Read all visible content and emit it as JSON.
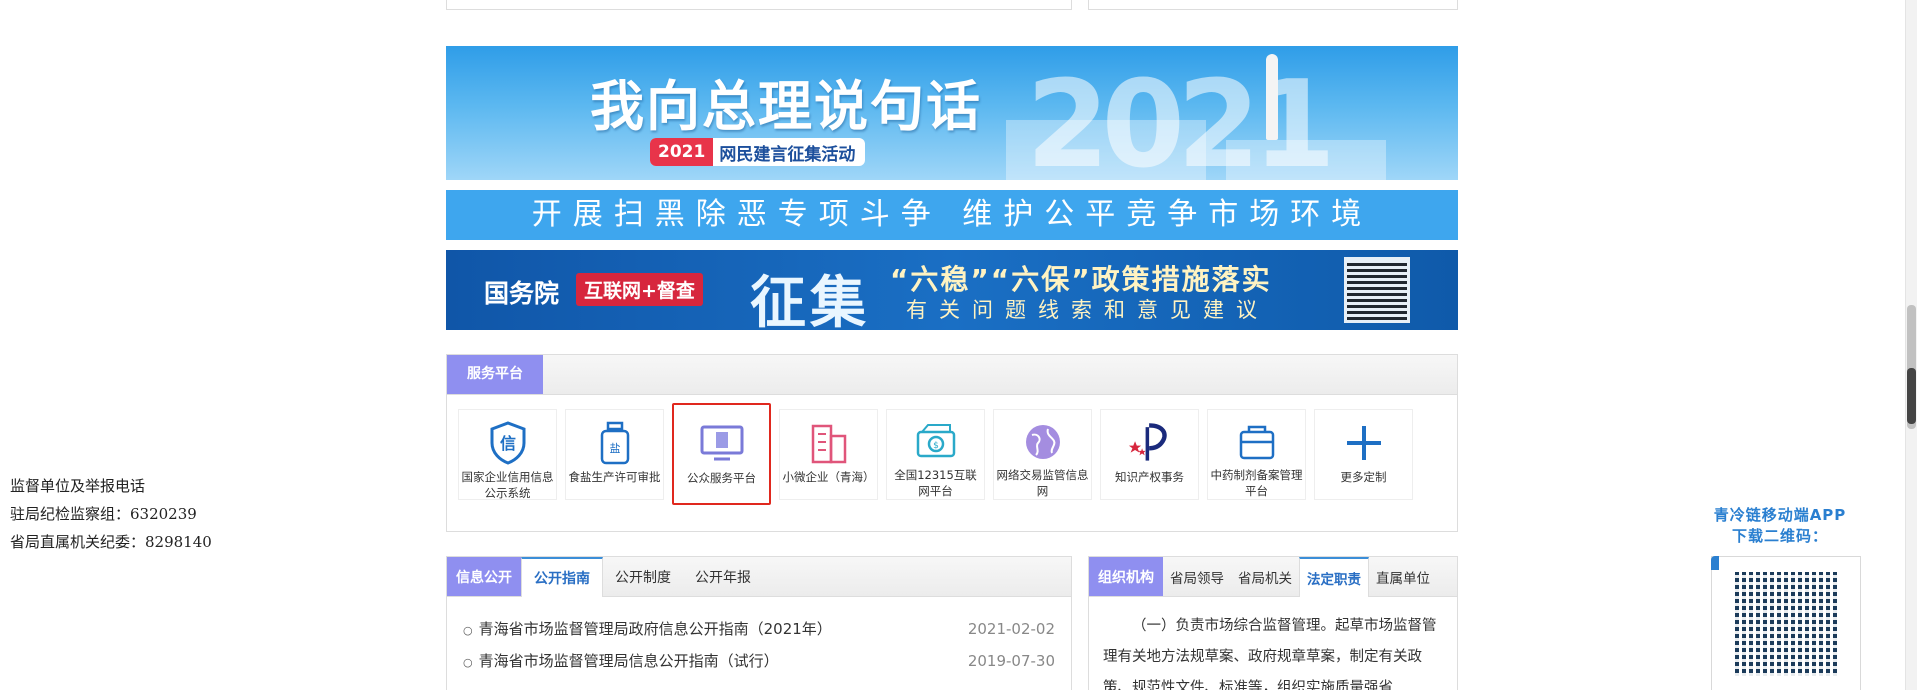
{
  "left_info": {
    "line1": "监督单位及举报电话",
    "line2": "驻局纪检监察组：6320239",
    "line3": "省局直属机关纪委：8298140"
  },
  "banner1": {
    "title": "我向总理说句话",
    "year": "2021",
    "subtitle": "网民建言征集活动",
    "deco_year": "2021"
  },
  "banner2": {
    "text": "开展扫黑除恶专项斗争  维护公平竞争市场环境"
  },
  "banner3": {
    "gwy": "国务院",
    "hlw": "互联网+督查",
    "zj": "征集",
    "line1": "“六稳”“六保”政策措施落实",
    "line2": "有关问题线索和意见建议"
  },
  "service": {
    "tab": "服务平台",
    "items": [
      {
        "label": "国家企业信用信息公示系统",
        "icon": "credit-shield-icon"
      },
      {
        "label": "食盐生产许可审批",
        "icon": "salt-jar-icon"
      },
      {
        "label": "公众服务平台",
        "icon": "monitor-document-icon"
      },
      {
        "label": "小微企业（青海）",
        "icon": "building-icon"
      },
      {
        "label": "全国12315互联网平台",
        "icon": "money-bill-icon"
      },
      {
        "label": "网络交易监管信息网",
        "icon": "globe-icon"
      },
      {
        "label": "知识产权事务",
        "icon": "ip-logo-icon"
      },
      {
        "label": "中药制剂备案管理平台",
        "icon": "folder-icon"
      },
      {
        "label": "更多定制",
        "icon": "plus-icon"
      }
    ]
  },
  "info": {
    "lead": "信息公开",
    "tabs": [
      "公开指南",
      "公开制度",
      "公开年报"
    ],
    "rows": [
      {
        "title": "青海省市场监督管理局政府信息公开指南（2021年）",
        "date": "2021-02-02"
      },
      {
        "title": "青海省市场监督管理局信息公开指南（试行）",
        "date": "2019-07-30"
      }
    ]
  },
  "org": {
    "lead": "组织机构",
    "tabs": [
      "省局领导",
      "省局机关",
      "法定职责",
      "直属单位"
    ],
    "text": "（一）负责市场综合监督管理。起草市场监督管理有关地方法规草案、政府规章草案，制定有关政策、规范性文件、标准等，组织实施质量强省"
  },
  "app": {
    "line1": "青冷链移动端APP",
    "line2": "下载二维码："
  },
  "colors": {
    "accent_purple": "#8f8ff0",
    "banner_blue": "#3ea6ee",
    "active_red": "#e0281e"
  }
}
